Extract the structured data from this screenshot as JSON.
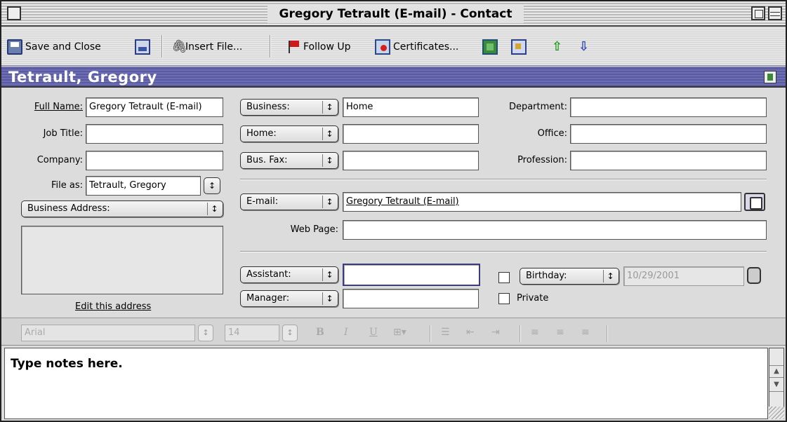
{
  "window": {
    "title": "Gregory Tetrault (E-mail) - Contact"
  },
  "toolbar": {
    "save_close": "Save and Close",
    "insert_file": "Insert File...",
    "follow_up": "Follow Up",
    "certificates": "Certificates..."
  },
  "header": {
    "name": "Tetrault, Gregory"
  },
  "left": {
    "full_name_label": "Full Name:",
    "full_name_value": "Gregory Tetrault (E-mail)",
    "job_title_label": "Job Title:",
    "job_title_value": "",
    "company_label": "Company:",
    "company_value": "",
    "file_as_label": "File as:",
    "file_as_value": "Tetrault, Gregory",
    "address_type": "Business Address:",
    "address_value": "",
    "edit_address": "Edit this address"
  },
  "phones": [
    {
      "type": "Business:",
      "value": "Home"
    },
    {
      "type": "Home:",
      "value": ""
    },
    {
      "type": "Bus. Fax:",
      "value": ""
    }
  ],
  "right": {
    "department_label": "Department:",
    "department_value": "",
    "office_label": "Office:",
    "office_value": "",
    "profession_label": "Profession:",
    "profession_value": ""
  },
  "email": {
    "type": "E-mail:",
    "value": "Gregory Tetrault (E-mail)",
    "web_page_label": "Web Page:",
    "web_page_value": ""
  },
  "people": {
    "assistant_type": "Assistant:",
    "assistant_value": "",
    "manager_type": "Manager:",
    "manager_value": "",
    "date_type": "Birthday:",
    "date_value": "10/29/2001",
    "private_label": "Private"
  },
  "format": {
    "font": "Arial",
    "size": "14",
    "bold": "B",
    "italic": "I",
    "underline": "U"
  },
  "notes": {
    "text": "Type notes here."
  }
}
